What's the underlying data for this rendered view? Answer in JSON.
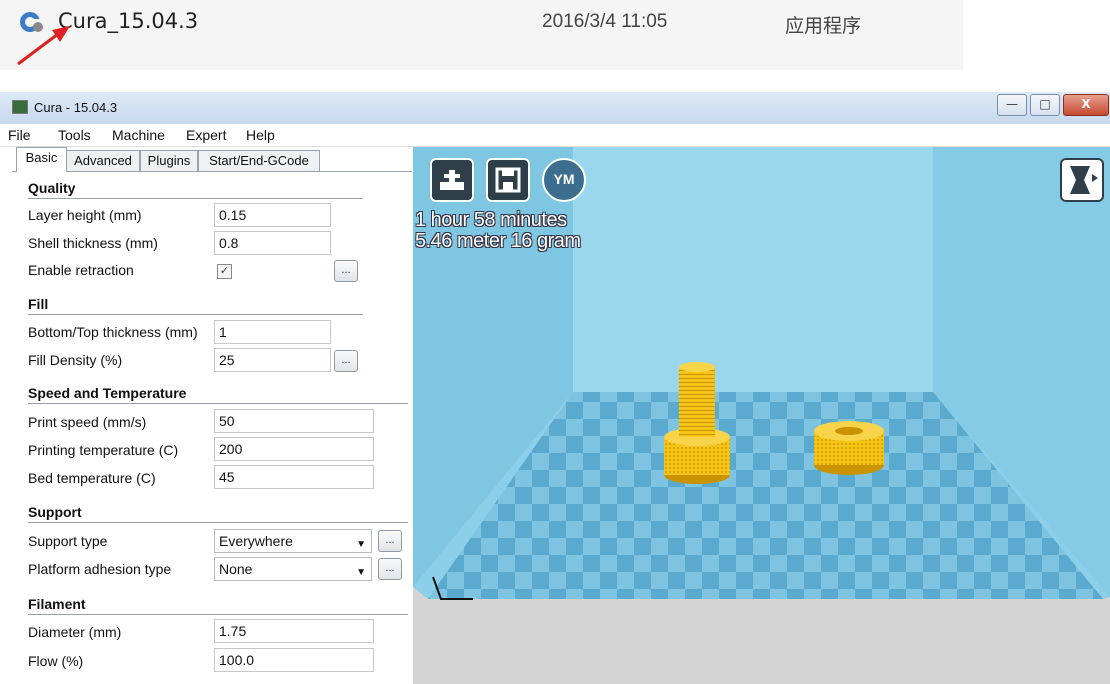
{
  "explorer": {
    "file_name": "Cura_15.04.3",
    "date_modified": "2016/3/4 11:05",
    "file_type": "应用程序"
  },
  "window": {
    "title": "Cura - 15.04.3",
    "minimize_label": "—",
    "maximize_label": "□",
    "close_label": "X"
  },
  "menu": [
    "File",
    "Tools",
    "Machine",
    "Expert",
    "Help"
  ],
  "tabs": [
    "Basic",
    "Advanced",
    "Plugins",
    "Start/End-GCode"
  ],
  "quality": {
    "title": "Quality",
    "layer_height_label": "Layer height (mm)",
    "layer_height_value": "0.15",
    "shell_thickness_label": "Shell thickness (mm)",
    "shell_thickness_value": "0.8",
    "retraction_label": "Enable retraction",
    "retraction_checked": "✓"
  },
  "fill": {
    "title": "Fill",
    "bottom_top_label": "Bottom/Top thickness (mm)",
    "bottom_top_value": "1",
    "density_label": "Fill Density (%)",
    "density_value": "25"
  },
  "speed": {
    "title": "Speed and Temperature",
    "print_speed_label": "Print speed (mm/s)",
    "print_speed_value": "50",
    "print_temp_label": "Printing temperature (C)",
    "print_temp_value": "200",
    "bed_temp_label": "Bed temperature (C)",
    "bed_temp_value": "45"
  },
  "support": {
    "title": "Support",
    "type_label": "Support type",
    "type_value": "Everywhere",
    "adhesion_label": "Platform adhesion type",
    "adhesion_value": "None"
  },
  "filament": {
    "title": "Filament",
    "diameter_label": "Diameter (mm)",
    "diameter_value": "1.75",
    "flow_label": "Flow (%)",
    "flow_value": "100.0"
  },
  "dots_label": "...",
  "viewport": {
    "print_time": "1 hour 58 minutes",
    "material": "5.46 meter 16 gram",
    "ym_label": "YM"
  },
  "colors": {
    "sky": "#8ccfe8",
    "floor": "#d4d4d4",
    "checker_light": "#7ec4e0",
    "checker_dark": "#5aa9cf",
    "model": "#f5c518",
    "arrow": "#e02020"
  }
}
